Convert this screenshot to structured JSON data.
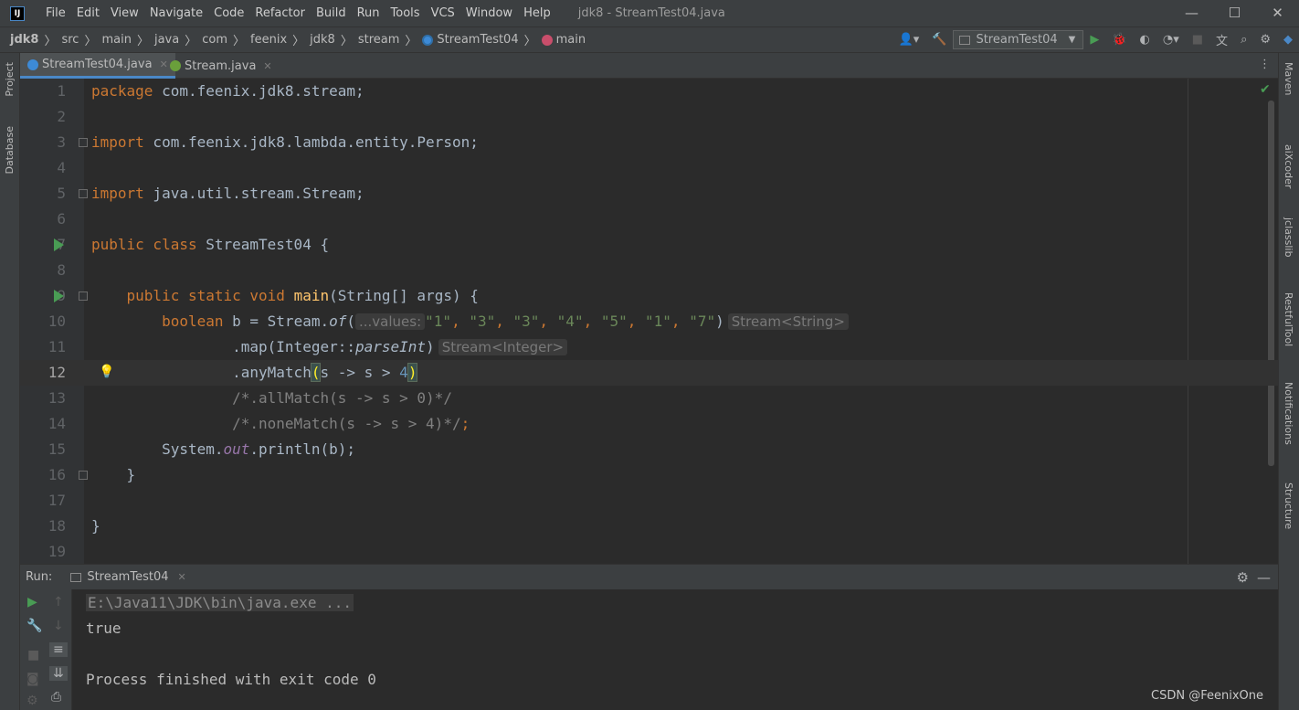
{
  "window": {
    "title": "jdk8 - StreamTest04.java",
    "logo": "IJ",
    "menu": [
      "File",
      "Edit",
      "View",
      "Navigate",
      "Code",
      "Refactor",
      "Build",
      "Run",
      "Tools",
      "VCS",
      "Window",
      "Help"
    ],
    "controls": {
      "minimize": "—",
      "maximize": "☐",
      "close": "✕"
    }
  },
  "breadcrumbs": [
    "jdk8",
    "src",
    "main",
    "java",
    "com",
    "feenix",
    "jdk8",
    "stream",
    "StreamTest04",
    "main"
  ],
  "toolbar": {
    "run_config": "StreamTest04"
  },
  "tabs": [
    {
      "label": "StreamTest04.java",
      "active": true
    },
    {
      "label": "Stream.java",
      "active": false
    }
  ],
  "left_strip": [
    "Project",
    "Database"
  ],
  "right_strip": [
    "Maven",
    "aiXcoder",
    "jclasslib",
    "RestfulTool",
    "Notifications",
    "Structure"
  ],
  "code": {
    "line_numbers": [
      "1",
      "2",
      "3",
      "4",
      "5",
      "6",
      "7",
      "8",
      "9",
      "10",
      "11",
      "12",
      "13",
      "14",
      "15",
      "16",
      "17",
      "18",
      "19"
    ],
    "l1": {
      "kw": "package",
      "rest": " com.feenix.jdk8.stream;"
    },
    "l3": {
      "kw": "import",
      "rest": " com.feenix.jdk8.lambda.entity.Person;"
    },
    "l5": {
      "kw": "import",
      "rest": " java.util.stream.Stream;"
    },
    "l7": {
      "kw": "public class",
      "name": " StreamTest04 {"
    },
    "l9": {
      "kw": "public static void",
      "fn": "main",
      "rest": "(String[] args) {"
    },
    "l10": {
      "kw": "boolean",
      "pre": " b = Stream.",
      "method": "of",
      "paren": "(",
      "hint": "...values:",
      "args": [
        "\"1\"",
        "\"3\"",
        "\"3\"",
        "\"4\"",
        "\"5\"",
        "\"1\"",
        "\"7\""
      ],
      "close": ")",
      "type_hint": "Stream<String>"
    },
    "l11": {
      "pre": ".map(Integer::",
      "method": "parseInt",
      "close": ")",
      "type_hint": "Stream<Integer>"
    },
    "l12": {
      "pre": ".anyMatch",
      "open": "(",
      "mid": "s -> s > ",
      "num": "4",
      "close": ")"
    },
    "l13": {
      "comment": "/*.allMatch(s -> s > 0)*/"
    },
    "l14": {
      "comment": "/*.noneMatch(s -> s > 4)*/",
      "semi": ";"
    },
    "l15": {
      "pre": "System.",
      "field": "out",
      "rest": ".println(b);"
    },
    "l16": {
      "text": "}"
    },
    "l18": {
      "text": "}"
    }
  },
  "run": {
    "label": "Run:",
    "tab": "StreamTest04",
    "command": "E:\\Java11\\JDK\\bin\\java.exe ...",
    "output": "true",
    "exit": "Process finished with exit code 0"
  },
  "watermark": "CSDN @FeenixOne"
}
